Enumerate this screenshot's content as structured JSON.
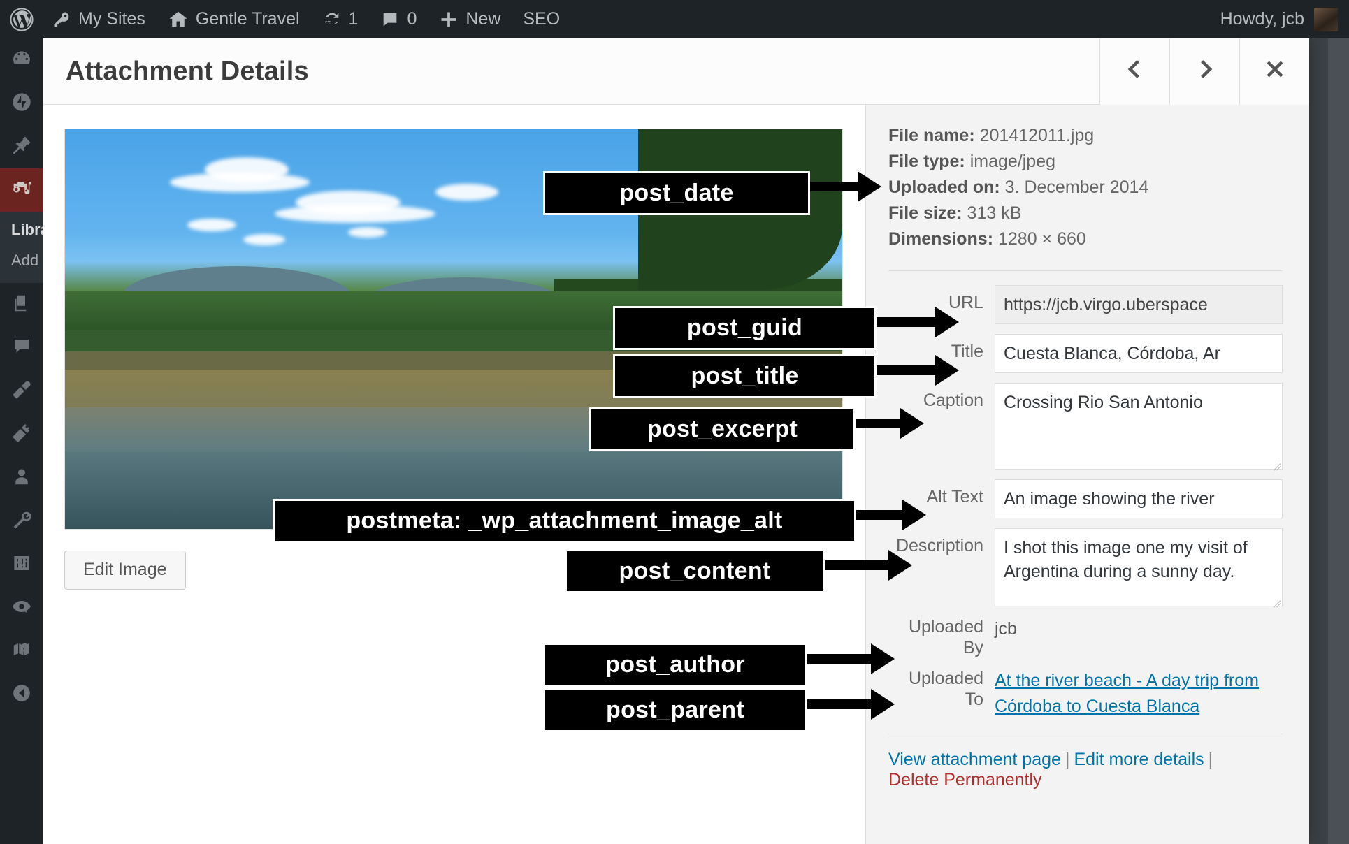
{
  "adminbar": {
    "logo_icon": "wordpress-icon",
    "items": [
      {
        "icon": "key-icon",
        "label": "My Sites"
      },
      {
        "icon": "home-icon",
        "label": "Gentle Travel"
      },
      {
        "icon": "refresh-icon",
        "label": "1"
      },
      {
        "icon": "comment-icon",
        "label": "0"
      },
      {
        "icon": "plus-icon",
        "label": "New"
      },
      {
        "icon": "",
        "label": "SEO"
      }
    ],
    "howdy": "Howdy, jcb"
  },
  "adminmenu": {
    "items": [
      {
        "icon": "dashboard-icon",
        "current": false
      },
      {
        "icon": "jetpack-icon",
        "current": false
      },
      {
        "icon": "pin-icon",
        "current": false
      },
      {
        "icon": "media-icon",
        "current": true
      },
      {
        "icon": "pages-icon",
        "current": false
      },
      {
        "icon": "comments-icon",
        "current": false
      },
      {
        "icon": "appearance-icon",
        "current": false
      },
      {
        "icon": "plugins-icon",
        "current": false
      },
      {
        "icon": "users-icon",
        "current": false
      },
      {
        "icon": "tools-icon",
        "current": false
      },
      {
        "icon": "settings-icon",
        "current": false
      },
      {
        "icon": "seo-eye-icon",
        "current": false
      },
      {
        "icon": "map-icon",
        "current": false
      },
      {
        "icon": "collapse-icon",
        "current": false
      }
    ],
    "submenu": [
      {
        "label": "Library",
        "current": true
      },
      {
        "label": "Add New",
        "current": false
      }
    ]
  },
  "modal": {
    "title": "Attachment Details",
    "prev_icon": "chevron-left-icon",
    "next_icon": "chevron-right-icon",
    "close_icon": "close-icon",
    "edit_image_label": "Edit Image"
  },
  "attachment": {
    "meta": [
      {
        "label": "File name:",
        "value": "201412011.jpg"
      },
      {
        "label": "File type:",
        "value": "image/jpeg"
      },
      {
        "label": "Uploaded on:",
        "value": "3. December 2014"
      },
      {
        "label": "File size:",
        "value": "313 kB"
      },
      {
        "label": "Dimensions:",
        "value": "1280 × 660"
      }
    ],
    "fields": [
      {
        "key": "url",
        "label": "URL",
        "value": "https://jcb.virgo.uberspace",
        "readonly": true,
        "type": "input"
      },
      {
        "key": "title",
        "label": "Title",
        "value": "Cuesta Blanca, Córdoba, Ar",
        "readonly": false,
        "type": "input"
      },
      {
        "key": "caption",
        "label": "Caption",
        "value": "Crossing Rio San Antonio",
        "readonly": false,
        "type": "textarea"
      },
      {
        "key": "alt",
        "label": "Alt Text",
        "value": "An image showing the river",
        "readonly": false,
        "type": "input"
      },
      {
        "key": "description",
        "label": "Description",
        "value": "I shot this image one my visit of Argentina during a sunny day.",
        "readonly": false,
        "type": "textarea"
      }
    ],
    "uploaded_by_label": "Uploaded By",
    "uploaded_by_value": "jcb",
    "uploaded_to_label": "Uploaded To",
    "uploaded_to_value": "At the river beach - A day trip from Córdoba to Cuesta Blanca",
    "actions": {
      "view": "View attachment page",
      "sep1": "|",
      "edit_more": "Edit more details",
      "sep2": "|",
      "delete": "Delete Permanently"
    }
  },
  "annotations": [
    {
      "key": "post_date",
      "label": "post_date"
    },
    {
      "key": "post_guid",
      "label": "post_guid"
    },
    {
      "key": "post_title",
      "label": "post_title"
    },
    {
      "key": "post_excerpt",
      "label": "post_excerpt"
    },
    {
      "key": "postmeta_alt",
      "label": "postmeta: _wp_attachment_image_alt"
    },
    {
      "key": "post_content",
      "label": "post_content"
    },
    {
      "key": "post_author",
      "label": "post_author"
    },
    {
      "key": "post_parent",
      "label": "post_parent"
    }
  ],
  "colors": {
    "admin_bg": "#1d2327",
    "accent_current": "#6b2420",
    "link": "#0073aa",
    "delete": "#b32d2e",
    "panel_bg": "#f3f3f3"
  }
}
